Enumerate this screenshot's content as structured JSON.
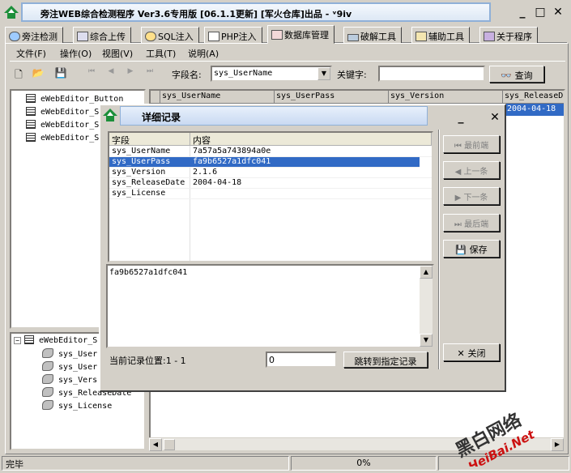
{
  "window": {
    "title": "旁注WEB综合检测程序 Ver3.6专用版 [06.1.1更新] [军火仓库]出品 - ᵛ9iv",
    "minimize": "_",
    "maximize": "□",
    "close": "✕"
  },
  "tabs": [
    {
      "label": "旁注检测",
      "icon": "globe-search-icon"
    },
    {
      "label": "综合上传",
      "icon": "upload-chart-icon"
    },
    {
      "label": "SQL注入",
      "icon": "magnifier-icon"
    },
    {
      "label": "PHP注入",
      "icon": "php-page-icon"
    },
    {
      "label": "数据库管理",
      "icon": "database-icon"
    },
    {
      "label": "破解工具",
      "icon": "keyboard-icon"
    },
    {
      "label": "辅助工具",
      "icon": "clipboard-icon"
    },
    {
      "label": "关于程序",
      "icon": "info-books-icon"
    }
  ],
  "active_tab": "数据库管理",
  "menu": [
    {
      "label": "文件(F)"
    },
    {
      "label": "操作(O)"
    },
    {
      "label": "视图(V)"
    },
    {
      "label": "工具(T)"
    },
    {
      "label": "说明(A)"
    }
  ],
  "toolbar": {
    "field_label": "字段名:",
    "field_value": "sys_UserName",
    "keyword_label": "关键字:",
    "keyword_value": "",
    "query_label": "查询"
  },
  "tables_tree": [
    "eWebEditor_Button",
    "eWebEditor_S",
    "eWebEditor_S",
    "eWebEditor_S"
  ],
  "fields_tree": {
    "root": "eWebEditor_S",
    "fields": [
      "sys_User",
      "sys_User",
      "sys_Vers",
      "sys_ReleaseDate",
      "sys_License"
    ]
  },
  "grid": {
    "columns": [
      "sys_UserName",
      "sys_UserPass",
      "sys_Version",
      "sys_ReleaseD"
    ],
    "visible_cell": "2004-04-18"
  },
  "dialog": {
    "title": "详细记录",
    "minimize": "_",
    "close": "✕",
    "columns": [
      "字段",
      "内容"
    ],
    "rows": [
      {
        "field": "sys_UserName",
        "value": "7a57a5a743894a0e",
        "selected": false
      },
      {
        "field": "sys_UserPass",
        "value": "fa9b6527a1dfc041",
        "selected": true
      },
      {
        "field": "sys_Version",
        "value": "2.1.6",
        "selected": false
      },
      {
        "field": "sys_ReleaseDate",
        "value": "2004-04-18",
        "selected": false
      },
      {
        "field": "sys_License",
        "value": "",
        "selected": false
      }
    ],
    "memo": "fa9b6527a1dfc041",
    "position_label": "当前记录位置:1 - 1",
    "jump_value": "0",
    "jump_button": "跳转到指定记录",
    "nav": {
      "first": "最前端",
      "prev": "上一条",
      "next": "下一条",
      "last": "最后端",
      "save": "保存",
      "close": "关闭"
    }
  },
  "status": {
    "left": "完毕",
    "progress": "0%"
  },
  "watermark": {
    "line1": "黑白网络",
    "line2": "HeiBai.Net"
  }
}
